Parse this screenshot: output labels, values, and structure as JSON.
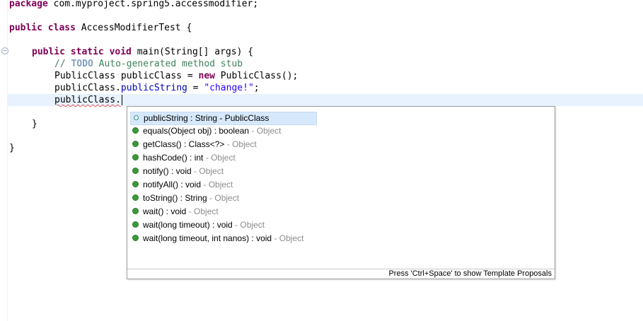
{
  "editor": {
    "lines": {
      "package_kw": "package",
      "package_rest": " com.myproject.spring5.accessmodifier;",
      "class_kw": "public class",
      "class_rest": " AccessModifierTest {",
      "main_kw1": "public static void",
      "main_rest": " main(String[] args) {",
      "comment_prefix": "// ",
      "comment_todo": "TODO",
      "comment_rest": " Auto-generated method stub",
      "decl_type": "PublicClass publicClass = ",
      "decl_new": "new",
      "decl_rest": " PublicClass();",
      "assign_obj": "publicClass.",
      "assign_field": "publicString",
      "assign_eq": " = ",
      "assign_str": "\"change!\"",
      "assign_end": ";",
      "current_text": "publicClass.",
      "close_method": "}",
      "close_class": "}"
    },
    "fold_marker": "−"
  },
  "popup": {
    "proposals": [
      {
        "name": "publicString : String",
        "owner": "PublicClass",
        "kind": "field"
      },
      {
        "name": "equals(Object obj) : boolean",
        "owner": "Object",
        "kind": "method"
      },
      {
        "name": "getClass() : Class<?>",
        "owner": "Object",
        "kind": "method"
      },
      {
        "name": "hashCode() : int",
        "owner": "Object",
        "kind": "method"
      },
      {
        "name": "notify() : void",
        "owner": "Object",
        "kind": "method"
      },
      {
        "name": "notifyAll() : void",
        "owner": "Object",
        "kind": "method"
      },
      {
        "name": "toString() : String",
        "owner": "Object",
        "kind": "method"
      },
      {
        "name": "wait() : void",
        "owner": "Object",
        "kind": "method"
      },
      {
        "name": "wait(long timeout) : void",
        "owner": "Object",
        "kind": "method"
      },
      {
        "name": "wait(long timeout, int nanos) : void",
        "owner": "Object",
        "kind": "method"
      }
    ],
    "separator": " - ",
    "hint": "Press 'Ctrl+Space' to show Template Proposals"
  },
  "colors": {
    "keyword": "#7f0055",
    "comment": "#3f7f5f",
    "string": "#2a00ff",
    "field": "#0000c0",
    "current_line": "#e8f2fe",
    "selection": "#d6e8fb"
  }
}
